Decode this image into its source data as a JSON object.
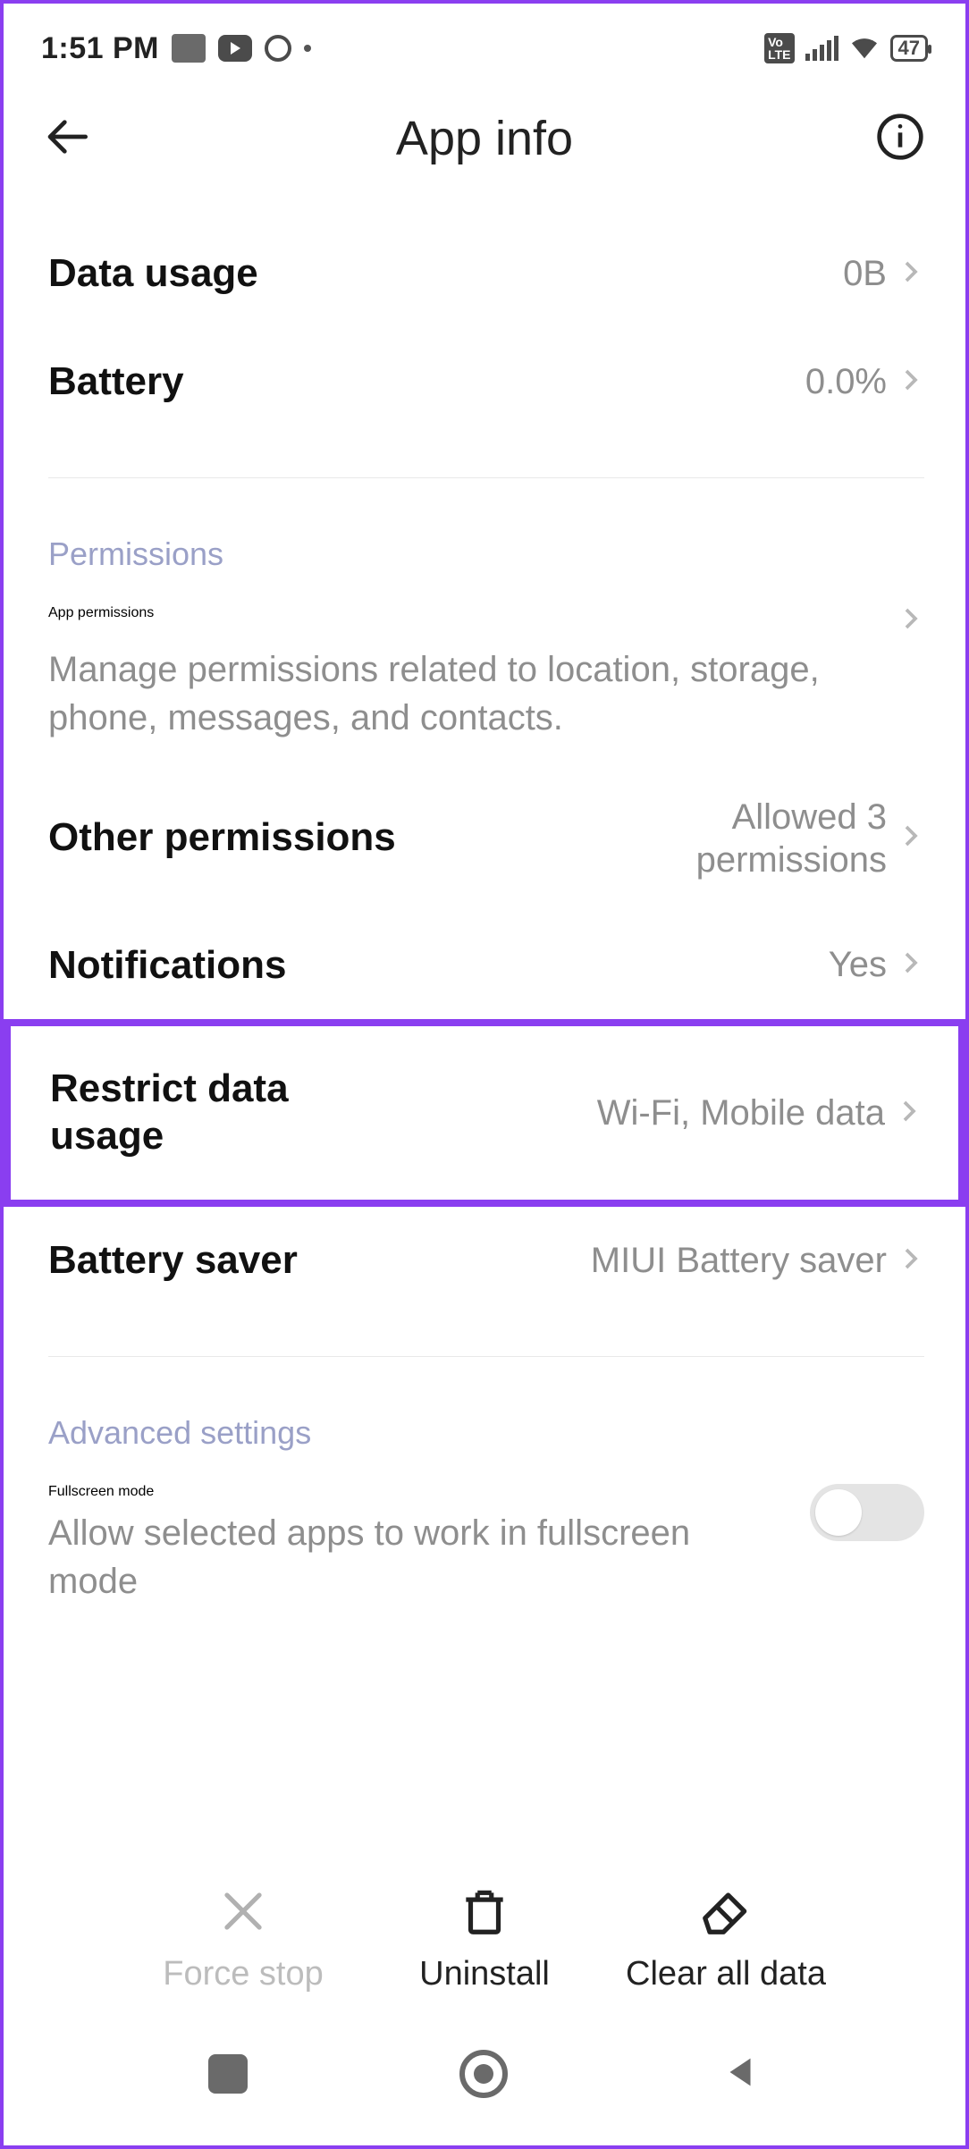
{
  "statusbar": {
    "time": "1:51 PM",
    "battery": "47"
  },
  "header": {
    "title": "App info"
  },
  "rows": {
    "data_usage": {
      "label": "Data usage",
      "value": "0B"
    },
    "battery": {
      "label": "Battery",
      "value": "0.0%"
    }
  },
  "sections": {
    "permissions": {
      "head": "Permissions",
      "app_perm": {
        "label": "App permissions",
        "sub": "Manage permissions related to location, storage, phone, messages, and contacts."
      },
      "other_perm": {
        "label": "Other permissions",
        "value": "Allowed 3 permissions"
      },
      "notifications": {
        "label": "Notifications",
        "value": "Yes"
      },
      "restrict": {
        "label": "Restrict data usage",
        "value": "Wi-Fi, Mobile data"
      },
      "batt_saver": {
        "label": "Battery saver",
        "value": "MIUI Battery saver"
      }
    },
    "advanced": {
      "head": "Advanced settings",
      "fullscreen": {
        "label": "Fullscreen mode",
        "sub": "Allow selected apps to work in fullscreen mode"
      }
    }
  },
  "actions": {
    "force_stop": "Force stop",
    "uninstall": "Uninstall",
    "clear_data": "Clear all data"
  }
}
